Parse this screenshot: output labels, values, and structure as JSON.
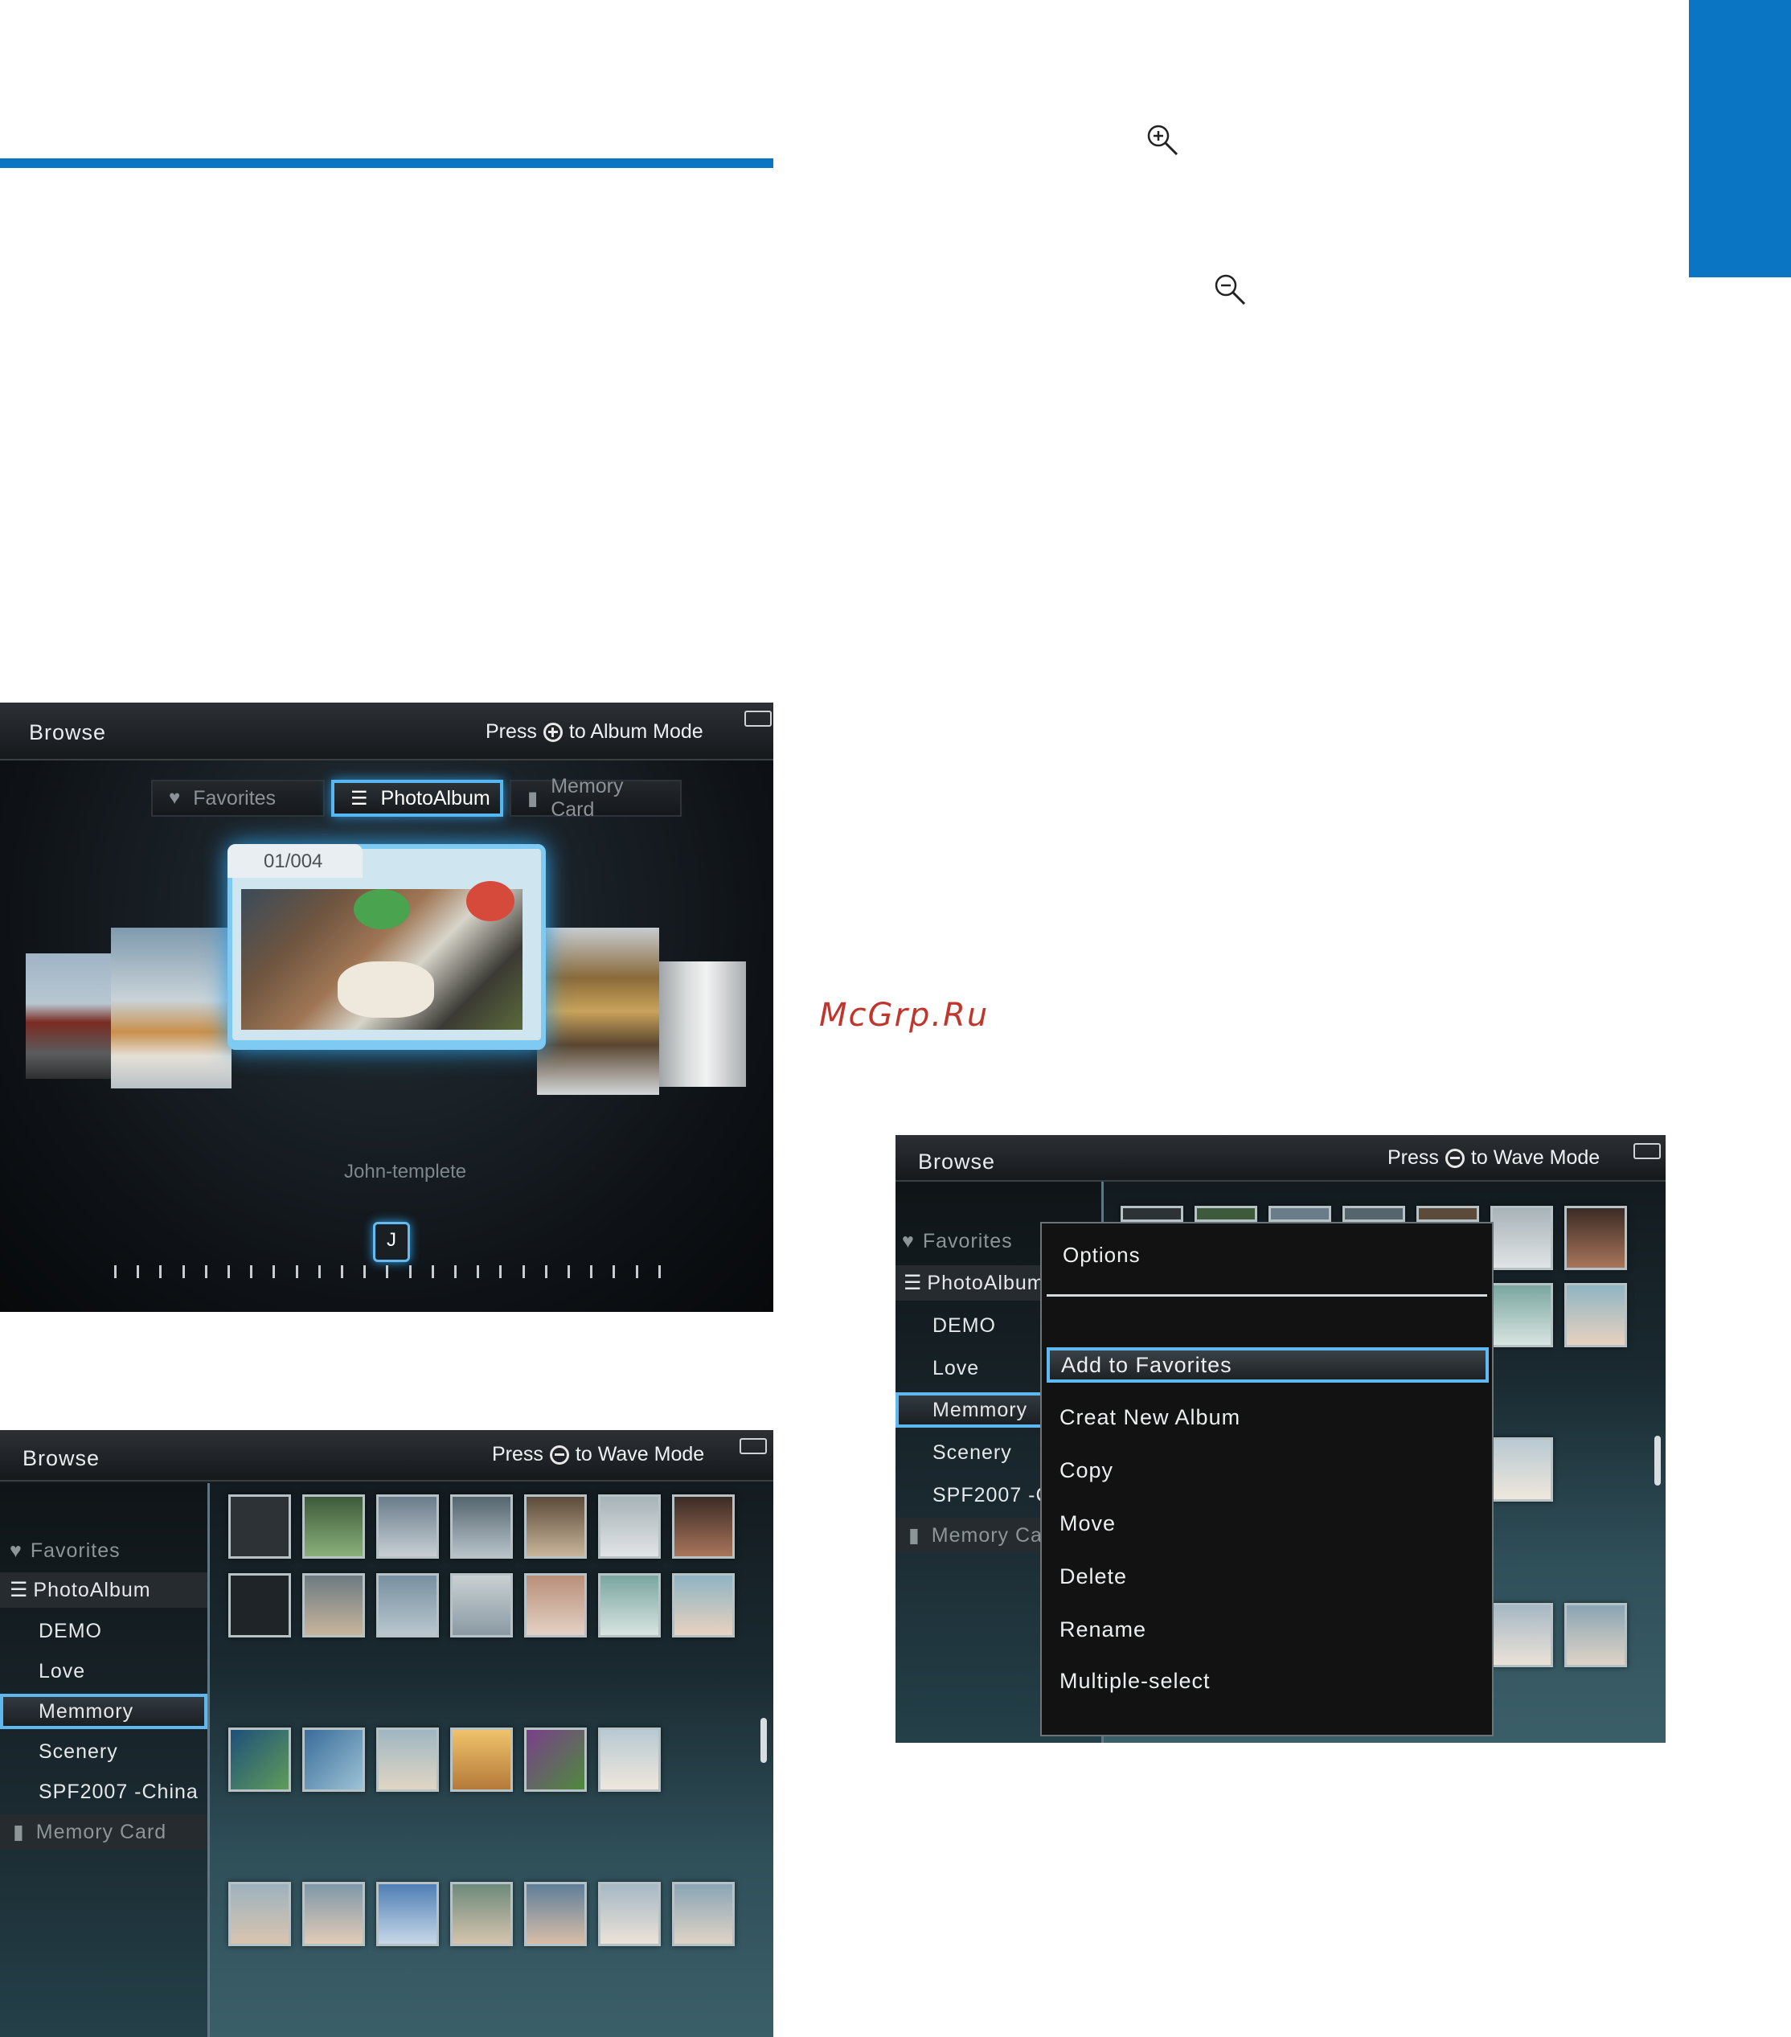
{
  "watermark": "McGrp.Ru",
  "icons": {
    "zoom_in": "zoom-in-icon",
    "zoom_out": "zoom-out-icon"
  },
  "colors": {
    "accent_blue": "#0a75c2",
    "highlight": "#5fb7ef",
    "watermark": "#c0362c"
  },
  "screen_album": {
    "title": "Browse",
    "hint_press": "Press",
    "hint_mode": "to Album Mode",
    "tabs": [
      "Favorites",
      "PhotoAlbum",
      "Memory Card"
    ],
    "active_tab": "PhotoAlbum",
    "album_counter": "01/004",
    "album_name": "John-templete",
    "slider_label": "J"
  },
  "screen_thumbs": {
    "title": "Browse",
    "hint_press": "Press",
    "hint_mode": "to Wave Mode",
    "sidebar": {
      "favorites": "Favorites",
      "photoalbum": "PhotoAlbum",
      "albums": [
        "DEMO",
        "Love",
        "Memmory",
        "Scenery",
        "SPF2007 -China"
      ],
      "selected": "Memmory",
      "memory_card": "Memory Card"
    }
  },
  "screen_options": {
    "title": "Browse",
    "hint_press": "Press",
    "hint_mode": "to Wave Mode",
    "sidebar": {
      "favorites": "Favorites",
      "photoalbum": "PhotoAlbum",
      "albums": [
        "DEMO",
        "Love",
        "Memmory",
        "Scenery",
        "SPF2007 -C"
      ],
      "memory_card": "Memory Card"
    },
    "menu": {
      "title": "Options",
      "items": [
        "Add to Favorites",
        "Creat New Album",
        "Copy",
        "Move",
        "Delete",
        "Rename",
        "Multiple-select"
      ],
      "selected": "Add to Favorites"
    }
  }
}
